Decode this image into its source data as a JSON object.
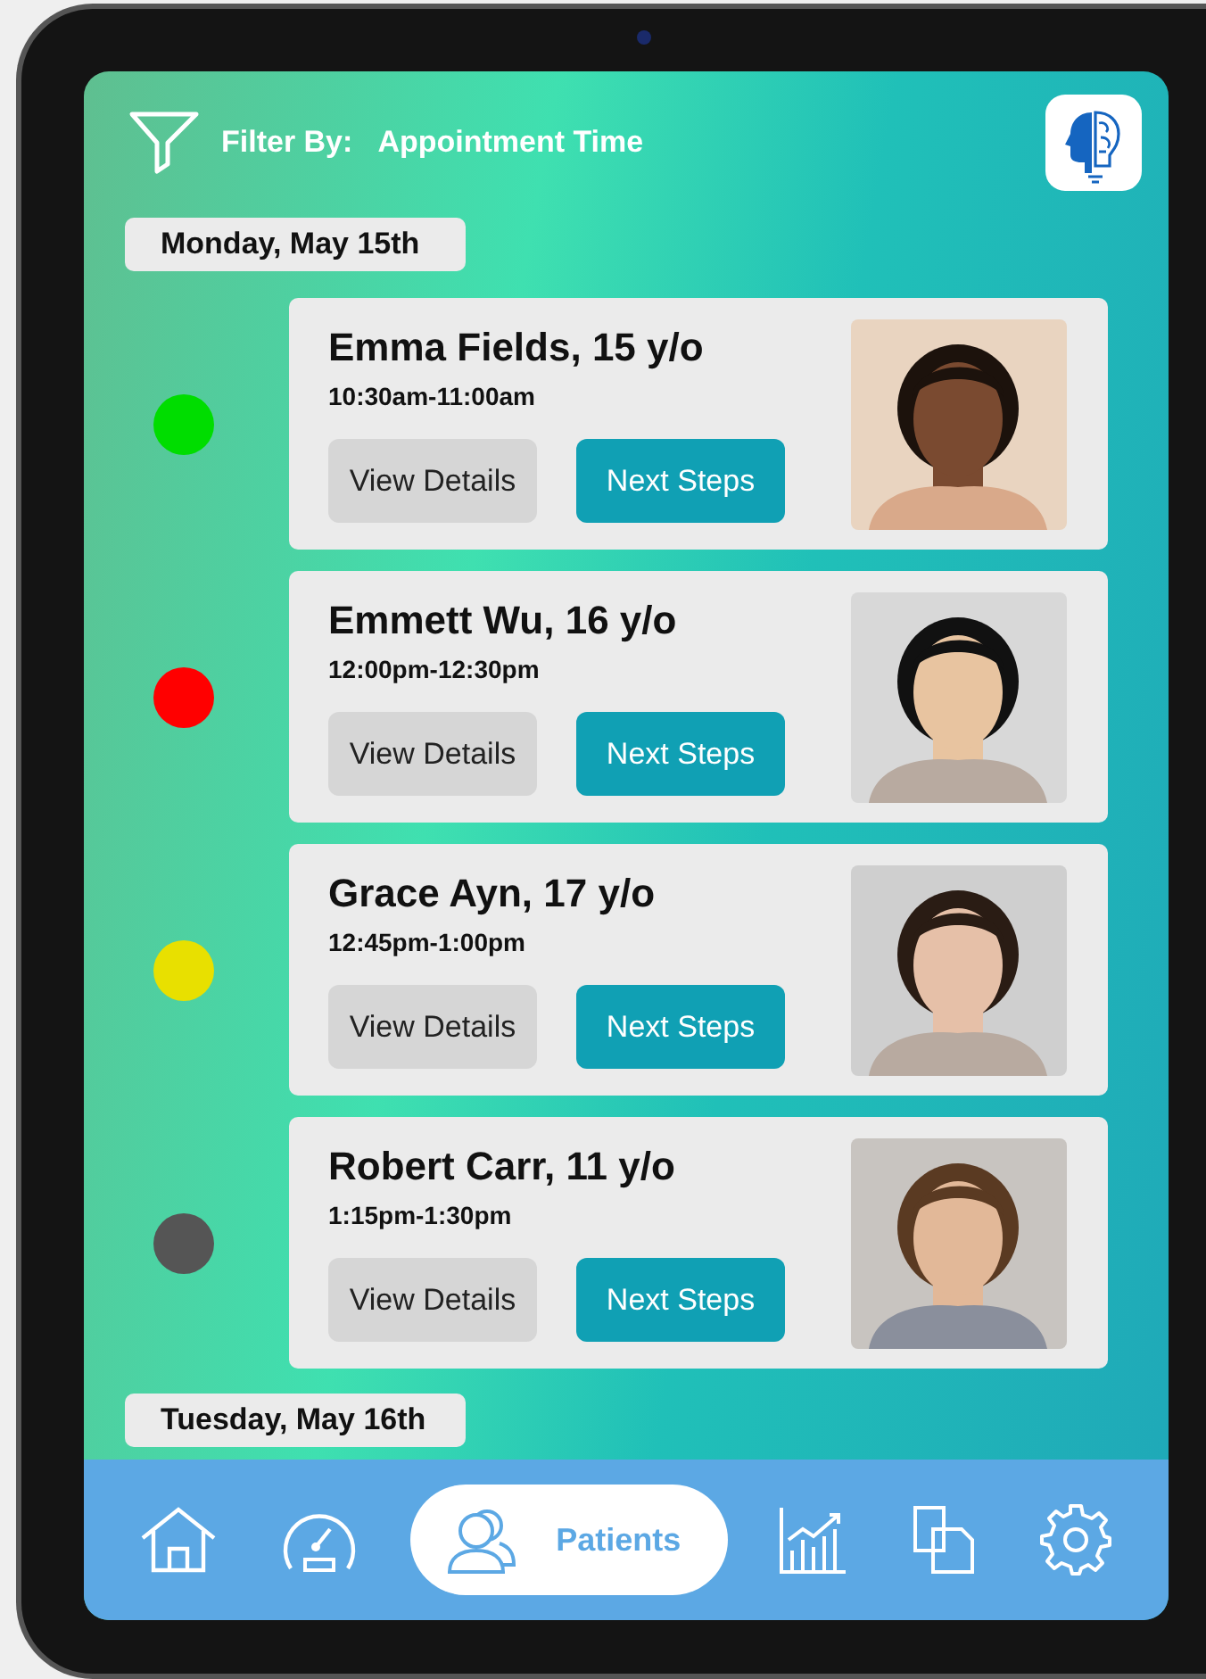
{
  "header": {
    "filter_label": "Filter By:",
    "filter_value": "Appointment Time"
  },
  "days": [
    {
      "date": "Monday, May 15th",
      "appointments": [
        {
          "name": "Emma Fields, 15 y/o",
          "time": "10:30am-11:00am",
          "color": "#00dd00",
          "details_button": "View Details",
          "next_button": "Next Steps"
        },
        {
          "name": "Emmett Wu, 16 y/o",
          "time": "12:00pm-12:30pm",
          "color": "#ff0000",
          "details_button": "View Details",
          "next_button": "Next Steps"
        },
        {
          "name": "Grace Ayn, 17 y/o",
          "time": "12:45pm-1:00pm",
          "color": "#e8e000",
          "details_button": "View Details",
          "next_button": "Next Steps"
        },
        {
          "name": "Robert Carr, 11 y/o",
          "time": "1:15pm-1:30pm",
          "color": "#555555",
          "details_button": "View Details",
          "next_button": "Next Steps"
        }
      ]
    },
    {
      "date": "Tuesday, May 16th"
    }
  ],
  "nav": [
    {
      "selected": false
    },
    {
      "selected": false
    },
    {
      "label": "Patients",
      "selected": true
    },
    {
      "selected": false
    },
    {
      "selected": false
    },
    {
      "selected": false
    }
  ]
}
